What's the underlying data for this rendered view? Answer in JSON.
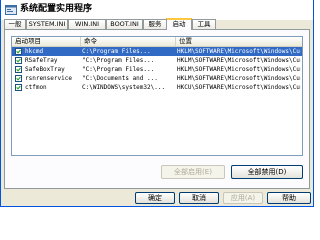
{
  "window": {
    "title": "系统配置实用程序"
  },
  "tabs": [
    {
      "label": "一般"
    },
    {
      "label": "SYSTEM.INI"
    },
    {
      "label": "WIN.INI"
    },
    {
      "label": "BOOT.INI"
    },
    {
      "label": "服务"
    },
    {
      "label": "启动",
      "selected": true
    },
    {
      "label": "工具"
    }
  ],
  "startup_list": {
    "columns": [
      "启动项目",
      "命令",
      "位置"
    ],
    "rows": [
      {
        "checked": true,
        "selected": true,
        "name": "hkcmd",
        "command": "C:\\Program Files...",
        "location": "HKLM\\SOFTWARE\\Microsoft\\Windows\\Current..."
      },
      {
        "checked": true,
        "selected": false,
        "name": "RSafeTray",
        "command": "\"C:\\Program Files...",
        "location": "HKLM\\SOFTWARE\\Microsoft\\Windows\\Current..."
      },
      {
        "checked": true,
        "selected": false,
        "name": "SafeBoxTray",
        "command": "\"C:\\Program Files...",
        "location": "HKLM\\SOFTWARE\\Microsoft\\Windows\\Current..."
      },
      {
        "checked": true,
        "selected": false,
        "name": "rsnrenservice",
        "command": "\"C:\\Documents and ...",
        "location": "HKLM\\SOFTWARE\\Microsoft\\Windows\\Current..."
      },
      {
        "checked": true,
        "selected": false,
        "name": "ctfmon",
        "command": "C:\\WINDOWS\\system32\\...",
        "location": "HKCU\\SOFTWARE\\Microsoft\\Windows\\Current..."
      }
    ]
  },
  "panel_buttons": {
    "enable_all": "全部启用(E)",
    "disable_all": "全部禁用(D)"
  },
  "footer_buttons": {
    "ok": "确定",
    "cancel": "取消",
    "apply": "应用(A)",
    "help": "帮助"
  },
  "colors": {
    "selection": "#316ac5",
    "active_tab_accent": "#ffc83c",
    "window_border": "#0054e3"
  }
}
